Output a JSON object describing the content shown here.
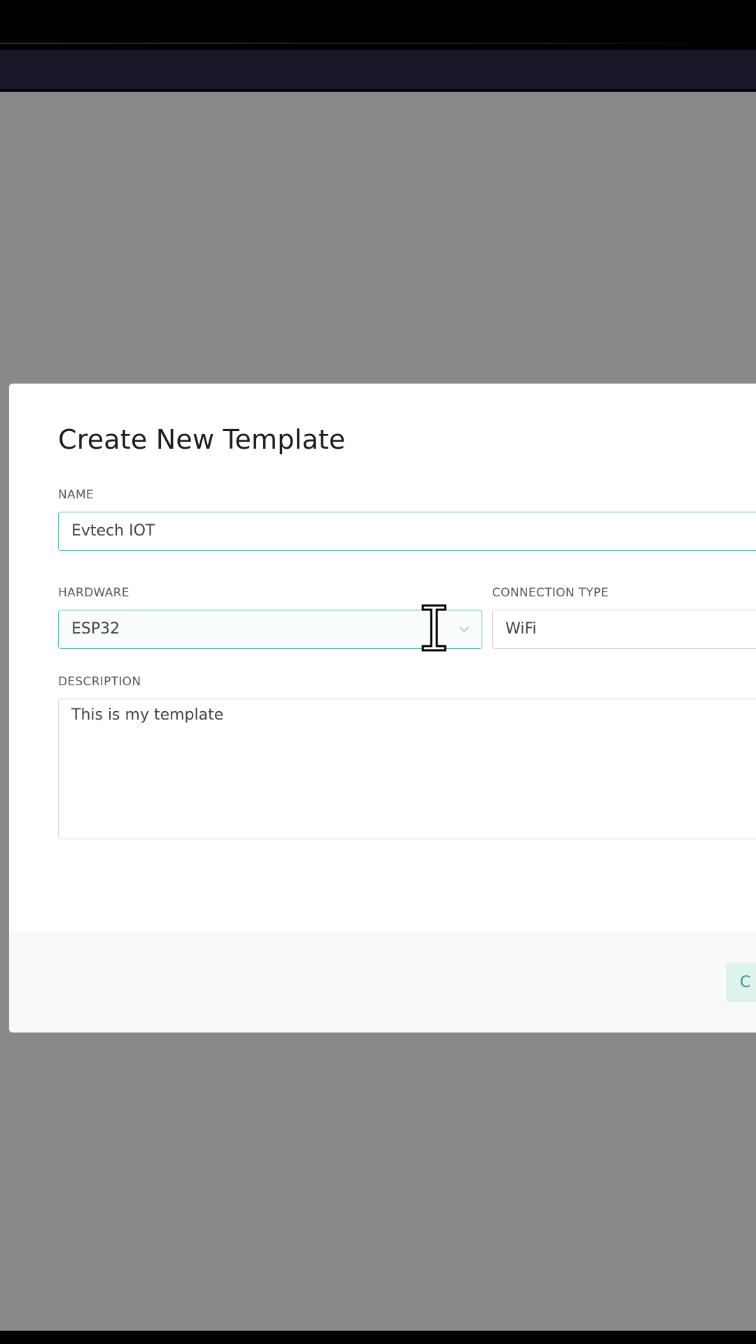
{
  "modal": {
    "title": "Create New Template",
    "name": {
      "label": "NAME",
      "value": "Evtech IOT"
    },
    "hardware": {
      "label": "HARDWARE",
      "value": "ESP32"
    },
    "connection_type": {
      "label": "CONNECTION TYPE",
      "value": "WiFi"
    },
    "description": {
      "label": "DESCRIPTION",
      "value": "This is my template"
    },
    "footer": {
      "primary_button_label": "C"
    }
  },
  "colors": {
    "overlay": "#8a888b",
    "header": "#1a1628",
    "focus_border": "#5dc2ac",
    "button_bg": "#dff3ee",
    "button_text": "#2e9a83"
  },
  "icons": [
    "chevron-down-icon",
    "text-cursor-icon"
  ]
}
